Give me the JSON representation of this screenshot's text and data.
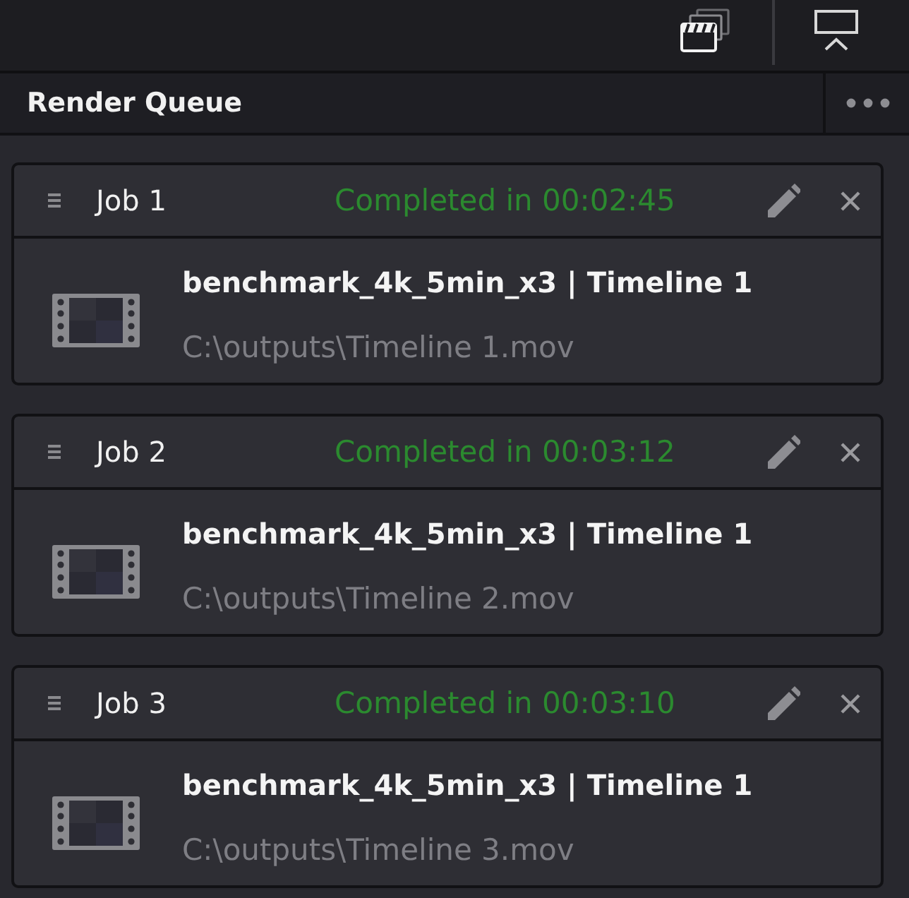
{
  "panel": {
    "title": "Render Queue"
  },
  "jobs": [
    {
      "name": "Job 1",
      "status": "Completed in 00:02:45",
      "completed": true,
      "title": "benchmark_4k_5min_x3 | Timeline 1",
      "path": "C:\\outputs\\Timeline 1.mov"
    },
    {
      "name": "Job 2",
      "status": "Completed in 00:03:12",
      "completed": true,
      "title": "benchmark_4k_5min_x3 | Timeline 1",
      "path": "C:\\outputs\\Timeline 2.mov"
    },
    {
      "name": "Job 3",
      "status": "Completed in 00:03:10",
      "completed": true,
      "title": "benchmark_4k_5min_x3 | Timeline 1",
      "path": "C:\\outputs\\Timeline 3.mov"
    }
  ]
}
